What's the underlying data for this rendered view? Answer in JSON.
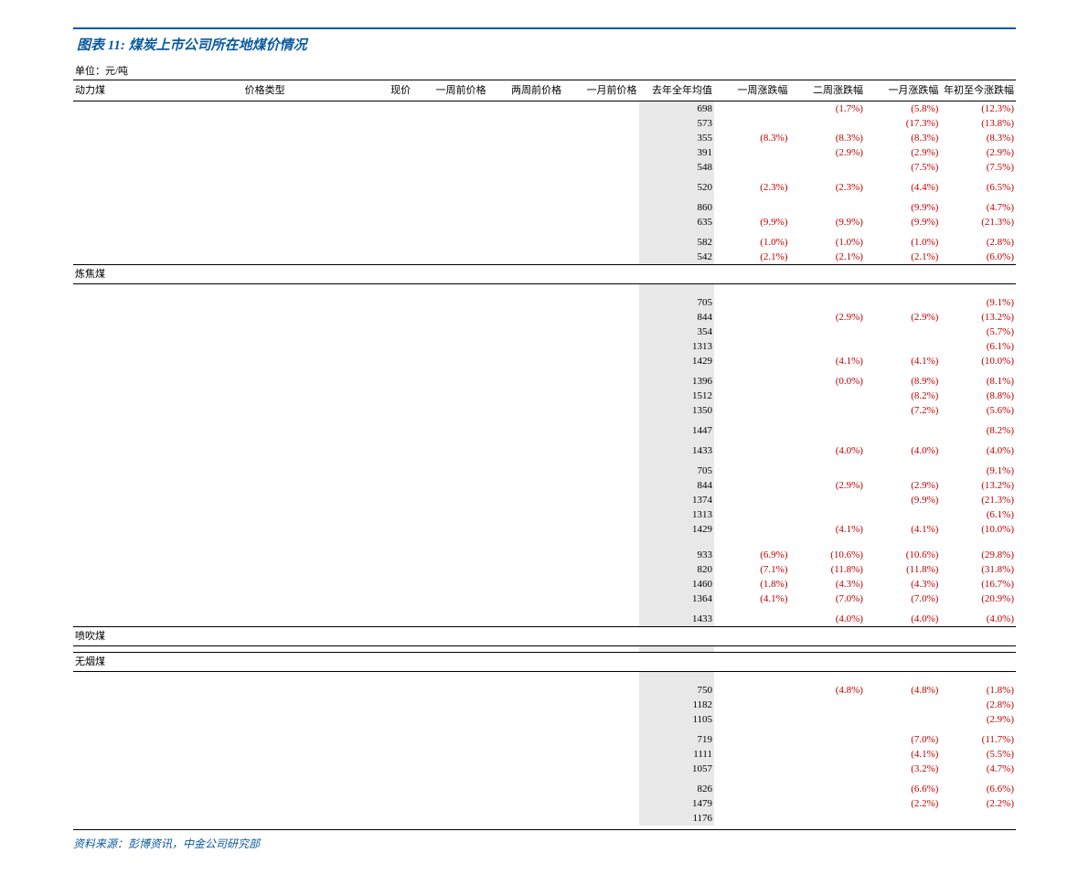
{
  "title": "图表 11: 煤炭上市公司所在地煤价情况",
  "unit": "单位：元/吨",
  "source": "资料来源：彭博资讯，中金公司研究部",
  "headers": [
    "动力煤",
    "价格类型",
    "现价",
    "一周前价格",
    "两周前价格",
    "一月前价格",
    "去年全年均值",
    "一周涨跌幅",
    "二周涨跌幅",
    "一月涨跌幅",
    "年初至今涨跌幅"
  ],
  "sections": [
    {
      "label": null,
      "rows": [
        {
          "c": [
            "",
            "",
            "",
            "",
            "",
            "",
            "698",
            "",
            "(1.7%)",
            "(5.8%)",
            "(12.3%)"
          ],
          "neg": [
            8,
            9,
            10
          ]
        },
        {
          "c": [
            "",
            "",
            "",
            "",
            "",
            "",
            "573",
            "",
            "",
            "(17.3%)",
            "(13.8%)"
          ],
          "neg": [
            9,
            10
          ]
        },
        {
          "c": [
            "",
            "",
            "",
            "",
            "",
            "",
            "355",
            "(8.3%)",
            "(8.3%)",
            "(8.3%)",
            "(8.3%)"
          ],
          "neg": [
            7,
            8,
            9,
            10
          ]
        },
        {
          "c": [
            "",
            "",
            "",
            "",
            "",
            "",
            "391",
            "",
            "(2.9%)",
            "(2.9%)",
            "(2.9%)"
          ],
          "neg": [
            8,
            9,
            10
          ]
        },
        {
          "c": [
            "",
            "",
            "",
            "",
            "",
            "",
            "548",
            "",
            "",
            "(7.5%)",
            "(7.5%)"
          ],
          "neg": [
            9,
            10
          ]
        },
        {
          "spacer": true
        },
        {
          "c": [
            "",
            "",
            "",
            "",
            "",
            "",
            "520",
            "(2.3%)",
            "(2.3%)",
            "(4.4%)",
            "(6.5%)"
          ],
          "neg": [
            7,
            8,
            9,
            10
          ]
        },
        {
          "spacer": true
        },
        {
          "c": [
            "",
            "",
            "",
            "",
            "",
            "",
            "860",
            "",
            "",
            "(9.9%)",
            "(4.7%)"
          ],
          "neg": [
            9,
            10
          ]
        },
        {
          "c": [
            "",
            "",
            "",
            "",
            "",
            "",
            "635",
            "(9.9%)",
            "(9.9%)",
            "(9.9%)",
            "(21.3%)"
          ],
          "neg": [
            7,
            8,
            9,
            10
          ]
        },
        {
          "spacer": true
        },
        {
          "c": [
            "",
            "",
            "",
            "",
            "",
            "",
            "582",
            "(1.0%)",
            "(1.0%)",
            "(1.0%)",
            "(2.8%)"
          ],
          "neg": [
            7,
            8,
            9,
            10
          ]
        },
        {
          "c": [
            "",
            "",
            "",
            "",
            "",
            "",
            "542",
            "(2.1%)",
            "(2.1%)",
            "(2.1%)",
            "(6.0%)"
          ],
          "neg": [
            7,
            8,
            9,
            10
          ]
        }
      ]
    },
    {
      "label": "炼焦煤",
      "rows": [
        {
          "spacer": true
        },
        {
          "spacer": true
        },
        {
          "c": [
            "",
            "",
            "",
            "",
            "",
            "",
            "705",
            "",
            "",
            "",
            "(9.1%)"
          ],
          "neg": [
            10
          ]
        },
        {
          "c": [
            "",
            "",
            "",
            "",
            "",
            "",
            "844",
            "",
            "(2.9%)",
            "(2.9%)",
            "(13.2%)"
          ],
          "neg": [
            8,
            9,
            10
          ]
        },
        {
          "c": [
            "",
            "",
            "",
            "",
            "",
            "",
            "354",
            "",
            "",
            "",
            "(5.7%)"
          ],
          "neg": [
            10
          ]
        },
        {
          "c": [
            "",
            "",
            "",
            "",
            "",
            "",
            "1313",
            "",
            "",
            "",
            "(6.1%)"
          ],
          "neg": [
            10
          ]
        },
        {
          "c": [
            "",
            "",
            "",
            "",
            "",
            "",
            "1429",
            "",
            "(4.1%)",
            "(4.1%)",
            "(10.0%)"
          ],
          "neg": [
            8,
            9,
            10
          ]
        },
        {
          "spacer": true
        },
        {
          "c": [
            "",
            "",
            "",
            "",
            "",
            "",
            "1396",
            "",
            "(0.0%)",
            "(8.9%)",
            "(8.1%)"
          ],
          "neg": [
            8,
            9,
            10
          ]
        },
        {
          "c": [
            "",
            "",
            "",
            "",
            "",
            "",
            "1512",
            "",
            "",
            "(8.2%)",
            "(8.8%)"
          ],
          "neg": [
            9,
            10
          ]
        },
        {
          "c": [
            "",
            "",
            "",
            "",
            "",
            "",
            "1350",
            "",
            "",
            "(7.2%)",
            "(5.6%)"
          ],
          "neg": [
            9,
            10
          ]
        },
        {
          "spacer": true
        },
        {
          "c": [
            "",
            "",
            "",
            "",
            "",
            "",
            "1447",
            "",
            "",
            "",
            "(8.2%)"
          ],
          "neg": [
            10
          ]
        },
        {
          "spacer": true
        },
        {
          "c": [
            "",
            "",
            "",
            "",
            "",
            "",
            "1433",
            "",
            "(4.0%)",
            "(4.0%)",
            "(4.0%)"
          ],
          "neg": [
            8,
            9,
            10
          ]
        },
        {
          "spacer": true
        },
        {
          "c": [
            "",
            "",
            "",
            "",
            "",
            "",
            "705",
            "",
            "",
            "",
            "(9.1%)"
          ],
          "neg": [
            10
          ]
        },
        {
          "c": [
            "",
            "",
            "",
            "",
            "",
            "",
            "844",
            "",
            "(2.9%)",
            "(2.9%)",
            "(13.2%)"
          ],
          "neg": [
            8,
            9,
            10
          ]
        },
        {
          "c": [
            "",
            "",
            "",
            "",
            "",
            "",
            "1374",
            "",
            "",
            "(9.9%)",
            "(21.3%)"
          ],
          "neg": [
            9,
            10
          ]
        },
        {
          "c": [
            "",
            "",
            "",
            "",
            "",
            "",
            "1313",
            "",
            "",
            "",
            "(6.1%)"
          ],
          "neg": [
            10
          ]
        },
        {
          "c": [
            "",
            "",
            "",
            "",
            "",
            "",
            "1429",
            "",
            "(4.1%)",
            "(4.1%)",
            "(10.0%)"
          ],
          "neg": [
            8,
            9,
            10
          ]
        },
        {
          "spacer": true
        },
        {
          "spacer": true
        },
        {
          "c": [
            "",
            "",
            "",
            "",
            "",
            "",
            "933",
            "(6.9%)",
            "(10.6%)",
            "(10.6%)",
            "(29.8%)"
          ],
          "neg": [
            7,
            8,
            9,
            10
          ]
        },
        {
          "c": [
            "",
            "",
            "",
            "",
            "",
            "",
            "820",
            "(7.1%)",
            "(11.8%)",
            "(11.8%)",
            "(31.8%)"
          ],
          "neg": [
            7,
            8,
            9,
            10
          ]
        },
        {
          "c": [
            "",
            "",
            "",
            "",
            "",
            "",
            "1460",
            "(1.8%)",
            "(4.3%)",
            "(4.3%)",
            "(16.7%)"
          ],
          "neg": [
            7,
            8,
            9,
            10
          ]
        },
        {
          "c": [
            "",
            "",
            "",
            "",
            "",
            "",
            "1364",
            "(4.1%)",
            "(7.0%)",
            "(7.0%)",
            "(20.9%)"
          ],
          "neg": [
            7,
            8,
            9,
            10
          ]
        },
        {
          "spacer": true
        },
        {
          "c": [
            "",
            "",
            "",
            "",
            "",
            "",
            "1433",
            "",
            "(4.0%)",
            "(4.0%)",
            "(4.0%)"
          ],
          "neg": [
            8,
            9,
            10
          ]
        }
      ]
    },
    {
      "label": "喷吹煤",
      "rows": [
        {
          "spacer": true
        }
      ]
    },
    {
      "label": "无烟煤",
      "rows": [
        {
          "spacer": true
        },
        {
          "spacer": true
        },
        {
          "c": [
            "",
            "",
            "",
            "",
            "",
            "",
            "750",
            "",
            "(4.8%)",
            "(4.8%)",
            "(1.8%)"
          ],
          "neg": [
            8,
            9,
            10
          ]
        },
        {
          "c": [
            "",
            "",
            "",
            "",
            "",
            "",
            "1182",
            "",
            "",
            "",
            "(2.8%)"
          ],
          "neg": [
            10
          ]
        },
        {
          "c": [
            "",
            "",
            "",
            "",
            "",
            "",
            "1105",
            "",
            "",
            "",
            "(2.9%)"
          ],
          "neg": [
            10
          ]
        },
        {
          "spacer": true
        },
        {
          "c": [
            "",
            "",
            "",
            "",
            "",
            "",
            "719",
            "",
            "",
            "(7.0%)",
            "(11.7%)"
          ],
          "neg": [
            9,
            10
          ]
        },
        {
          "c": [
            "",
            "",
            "",
            "",
            "",
            "",
            "1111",
            "",
            "",
            "(4.1%)",
            "(5.5%)"
          ],
          "neg": [
            9,
            10
          ]
        },
        {
          "c": [
            "",
            "",
            "",
            "",
            "",
            "",
            "1057",
            "",
            "",
            "(3.2%)",
            "(4.7%)"
          ],
          "neg": [
            9,
            10
          ]
        },
        {
          "spacer": true
        },
        {
          "c": [
            "",
            "",
            "",
            "",
            "",
            "",
            "826",
            "",
            "",
            "(6.6%)",
            "(6.6%)"
          ],
          "neg": [
            9,
            10
          ]
        },
        {
          "c": [
            "",
            "",
            "",
            "",
            "",
            "",
            "1479",
            "",
            "",
            "(2.2%)",
            "(2.2%)"
          ],
          "neg": [
            9,
            10
          ]
        },
        {
          "c": [
            "",
            "",
            "",
            "",
            "",
            "",
            "1176",
            "",
            "",
            "",
            ""
          ],
          "neg": []
        }
      ]
    }
  ]
}
